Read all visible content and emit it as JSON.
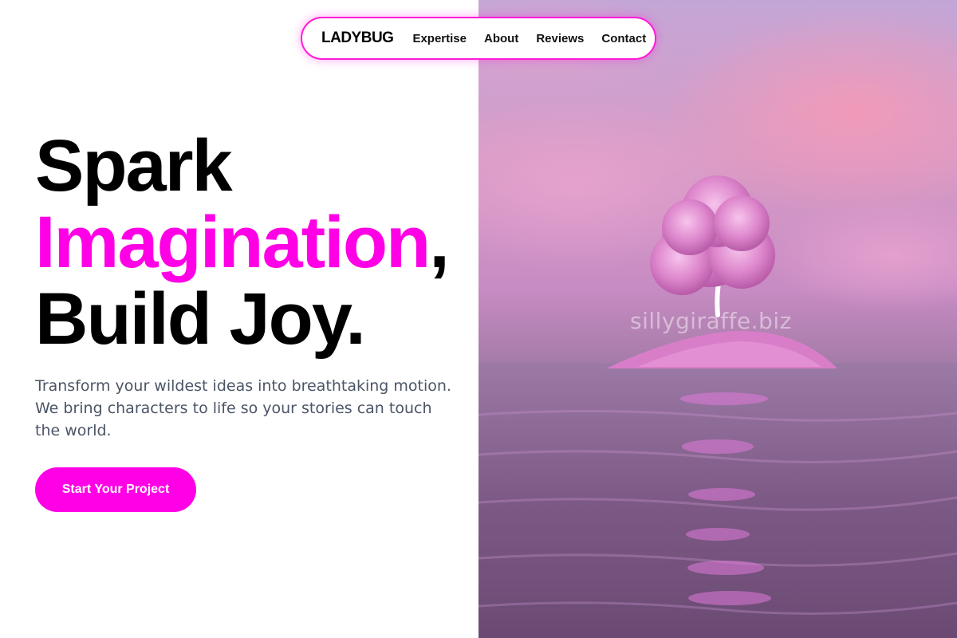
{
  "nav": {
    "brand": "LADYBUG",
    "links": [
      "Expertise",
      "About",
      "Reviews",
      "Contact"
    ]
  },
  "hero": {
    "line1": "Spark",
    "line2_accent": "Imagination",
    "line2_punct": ",",
    "line3": "Build Joy.",
    "subtitle": "Transform your wildest ideas into breathtaking motion. We bring characters to life so your stories can touch the world.",
    "cta_label": "Start Your Project"
  },
  "image": {
    "watermark": "sillygiraffe.biz"
  },
  "colors": {
    "accent": "#ff00e6",
    "text": "#000000",
    "subtext": "#4b5566"
  }
}
